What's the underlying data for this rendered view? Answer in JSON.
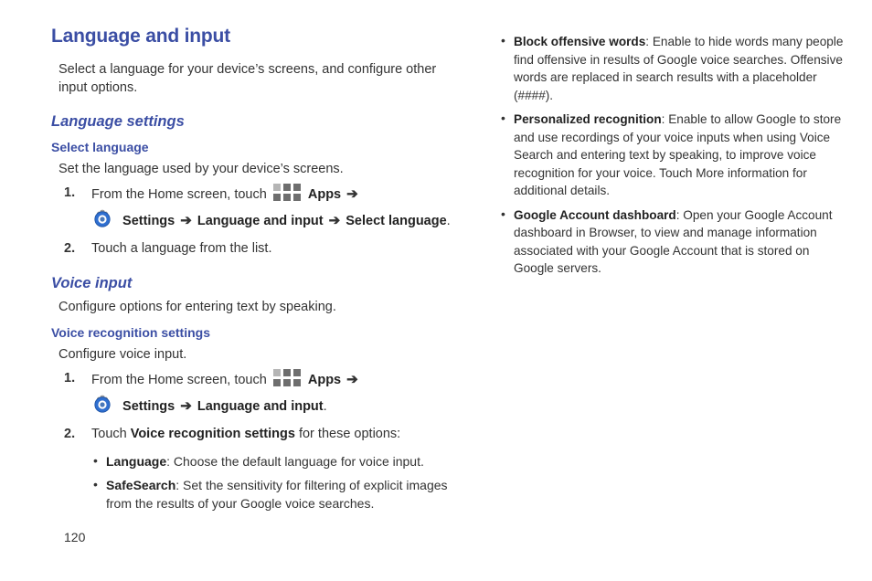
{
  "document": {
    "title": "Language and input",
    "intro": "Select a language for your device’s screens, and configure other input options.",
    "page_number": "120",
    "accent_color": "#3b4ea4",
    "body_color": "#333333"
  },
  "icons": {
    "apps": "apps-grid-icon",
    "settings": "settings-gear-icon",
    "arrow": "➔"
  },
  "left_column": {
    "language_settings": {
      "heading": "Language settings",
      "select_language": {
        "heading": "Select language",
        "intro": "Set the language used by your device’s screens.",
        "steps": [
          {
            "num": "1.",
            "line1_pre": "From the Home screen, touch",
            "line1_apps_label": "Apps",
            "line2_settings_label": "Settings",
            "line2_path1": "Language and input",
            "line2_path2": "Select language",
            "line2_end": "."
          },
          {
            "num": "2.",
            "text": "Touch a language from the list."
          }
        ]
      }
    },
    "voice_input": {
      "heading": "Voice input",
      "intro": "Configure options for entering text by speaking.",
      "voice_recognition": {
        "heading": "Voice recognition settings",
        "intro": "Configure voice input.",
        "steps": [
          {
            "num": "1.",
            "line1_pre": "From the Home screen, touch",
            "line1_apps_label": "Apps",
            "line2_settings_label": "Settings",
            "line2_path1": "Language and input",
            "line2_end": "."
          },
          {
            "num": "2.",
            "pre": "Touch",
            "term": "Voice recognition settings",
            "post": "for these options:"
          }
        ],
        "options": [
          {
            "term": "Language",
            "description": ": Choose the default language for voice input."
          },
          {
            "term": "SafeSearch",
            "description": ": Set the sensitivity for filtering of explicit images from the results of your Google voice searches."
          }
        ]
      }
    }
  },
  "right_column": {
    "options": [
      {
        "term": "Block offensive words",
        "description": ": Enable to hide words many people find offensive in results of Google voice searches. Offensive words are replaced in search results with a placeholder (####)."
      },
      {
        "term": "Personalized recognition",
        "description": ": Enable to allow Google to store and use recordings of your voice inputs when using Voice Search and entering text by speaking, to improve voice recognition for your voice. Touch More information for additional details."
      },
      {
        "term": "Google Account dashboard",
        "description": ": Open your Google Account dashboard in Browser, to view and manage information associated with your Google Account that is stored on Google servers."
      }
    ]
  }
}
